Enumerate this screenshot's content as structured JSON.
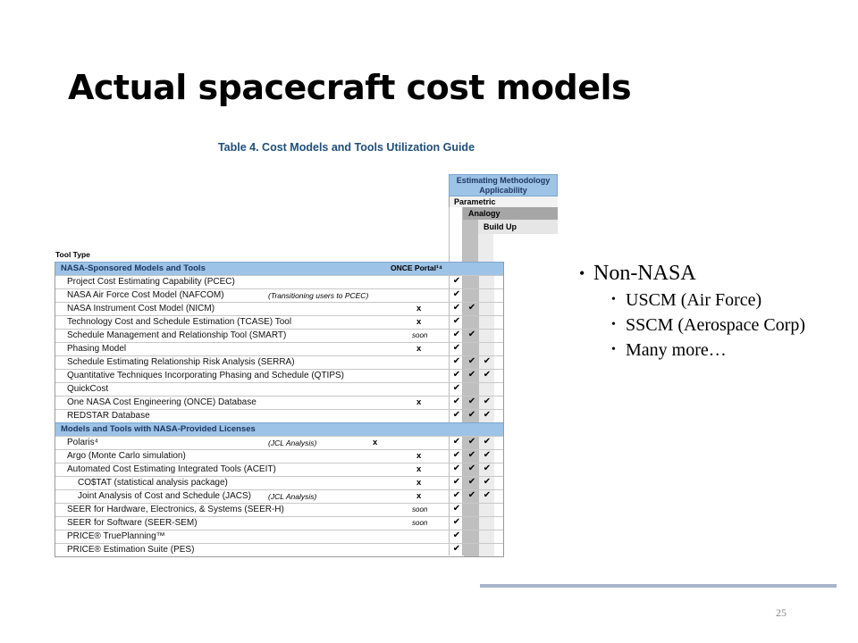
{
  "slide": {
    "title": "Actual spacecraft cost models",
    "page_number": "25"
  },
  "table": {
    "caption": "Table 4. Cost Models and Tools Utilization Guide",
    "methodology_header": "Estimating Methodology Applicability",
    "col_parametric": "Parametric",
    "col_analogy": "Analogy",
    "col_buildup": "Build Up",
    "tool_type_label": "Tool Type",
    "rows": [
      {
        "type": "section",
        "name": "NASA-Sponsored Models and Tools",
        "portal": "ONCE Portal¹⁴"
      },
      {
        "name": "Project Cost Estimating Capability (PCEC)",
        "checks": [
          true,
          false,
          false
        ]
      },
      {
        "name": "NASA Air Force Cost Model (NAFCOM)",
        "note": "(Transitioning users to PCEC)",
        "checks": [
          true,
          false,
          false
        ]
      },
      {
        "name": "NASA Instrument Cost Model (NICM)",
        "x": "x",
        "checks": [
          true,
          true,
          false
        ]
      },
      {
        "name": "Technology Cost and Schedule Estimation (TCASE) Tool",
        "x": "x",
        "checks": [
          true,
          false,
          false
        ]
      },
      {
        "name": "Schedule Management and Relationship Tool (SMART)",
        "soon": "soon",
        "checks": [
          true,
          true,
          false
        ]
      },
      {
        "name": "Phasing Model",
        "x": "x",
        "checks": [
          true,
          false,
          false
        ]
      },
      {
        "name": "Schedule Estimating Relationship Risk Analysis (SERRA)",
        "checks": [
          true,
          true,
          true
        ]
      },
      {
        "name": "Quantitative Techniques Incorporating Phasing and Schedule (QTIPS)",
        "checks": [
          true,
          true,
          true
        ]
      },
      {
        "name": "QuickCost",
        "checks": [
          true,
          false,
          false
        ]
      },
      {
        "name": "One NASA Cost Engineering (ONCE) Database",
        "x": "x",
        "checks": [
          true,
          true,
          true
        ]
      },
      {
        "name": "REDSTAR Database",
        "checks": [
          true,
          true,
          true
        ]
      },
      {
        "type": "section",
        "name": "Models and Tools with NASA-Provided Licenses"
      },
      {
        "name": "Polaris⁴",
        "note": "(JCL Analysis)",
        "xleft": "x",
        "checks": [
          true,
          true,
          true
        ]
      },
      {
        "name": "Argo (Monte Carlo simulation)",
        "x": "x",
        "checks": [
          true,
          true,
          true
        ]
      },
      {
        "name": "Automated Cost Estimating Integrated Tools (ACEIT)",
        "x": "x",
        "checks": [
          true,
          true,
          true
        ]
      },
      {
        "name": "CO$TAT (statistical analysis package)",
        "indent": true,
        "x": "x",
        "checks": [
          true,
          true,
          true
        ]
      },
      {
        "name": "Joint Analysis of Cost and Schedule (JACS)",
        "indent": true,
        "note": "(JCL Analysis)",
        "x": "x",
        "checks": [
          true,
          true,
          true
        ]
      },
      {
        "name": "SEER for Hardware, Electronics, & Systems (SEER-H)",
        "soon": "soon",
        "checks": [
          true,
          false,
          false
        ]
      },
      {
        "name": "SEER for Software (SEER-SEM)",
        "soon": "soon",
        "checks": [
          true,
          false,
          false
        ]
      },
      {
        "name": "PRICE® TruePlanning™",
        "checks": [
          true,
          false,
          false
        ]
      },
      {
        "name": "PRICE® Estimation Suite (PES)",
        "checks": [
          true,
          false,
          false
        ]
      }
    ]
  },
  "bullets": {
    "main": "Non-NASA",
    "sub": [
      "USCM (Air Force)",
      "SSCM (Aerospace Corp)",
      "Many more…"
    ]
  },
  "check_glyph": "✔"
}
